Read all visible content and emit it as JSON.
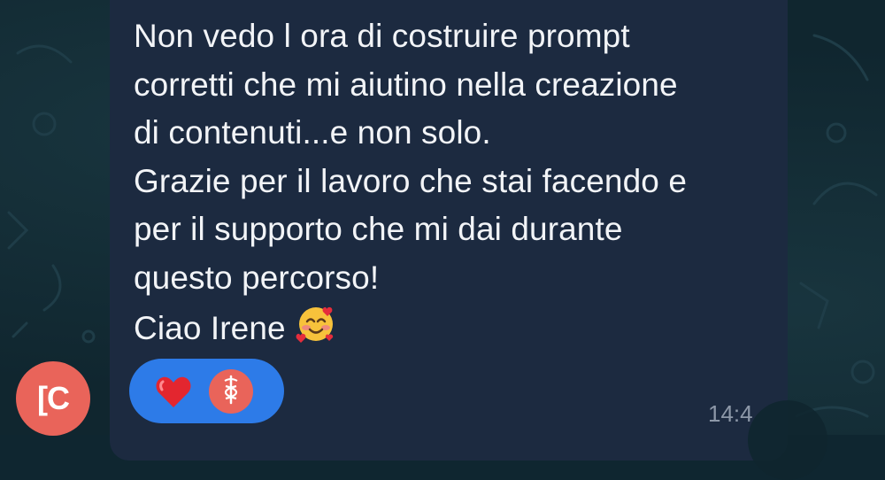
{
  "message": {
    "lines": [
      "Non vedo l ora di costruire prompt",
      "corretti che mi aiutino nella creazione",
      "di contenuti...e non solo.",
      "Grazie per il lavoro che stai facendo e",
      "per il supporto che mi dai durante",
      "questo percorso!",
      "Ciao Irene"
    ],
    "emoji": "smiling-face-with-hearts",
    "time": "14:4"
  },
  "sender": {
    "avatar_text": "[C"
  },
  "reactions": [
    {
      "type": "heart",
      "icon": "red-heart-icon"
    },
    {
      "type": "reactor-avatar",
      "icon": "caduceus-icon"
    }
  ],
  "colors": {
    "background": "#10262f",
    "bubble": "#1c2a40",
    "text": "#f2f4f7",
    "reaction_pill": "#2d7be8",
    "avatar": "#e9645a",
    "time": "#8d98a8"
  }
}
